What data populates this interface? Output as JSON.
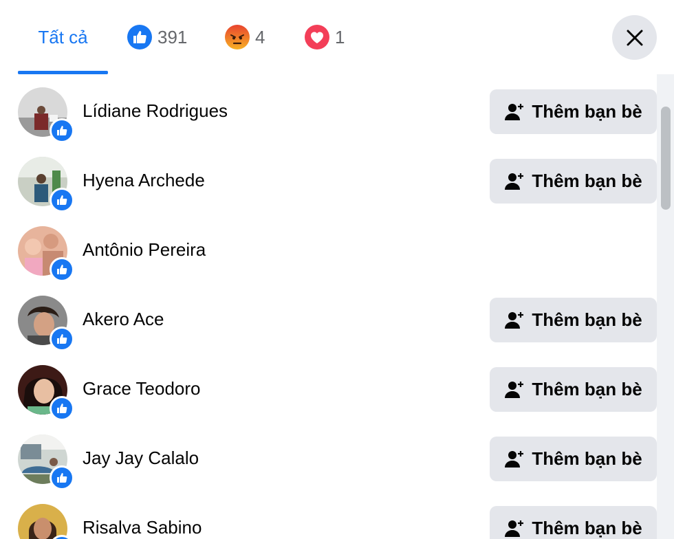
{
  "tabs": {
    "all_label": "Tất cả",
    "like_count": "391",
    "angry_count": "4",
    "love_count": "1"
  },
  "colors": {
    "accent": "#1877f2",
    "button_bg": "#e4e6eb",
    "like": "#1877f2",
    "angry": "#f0543c",
    "love": "#f33e58"
  },
  "icons": {
    "like": "thumbs-up-icon",
    "angry": "angry-face-icon",
    "love": "heart-icon",
    "close": "close-icon",
    "add_friend": "person-add-icon"
  },
  "people": [
    {
      "name": "Lídiane Rodrigues",
      "reaction": "like",
      "show_add": true,
      "button_label": "Thêm bạn bè"
    },
    {
      "name": "Hyena Archede",
      "reaction": "like",
      "show_add": true,
      "button_label": "Thêm bạn bè"
    },
    {
      "name": "Antônio Pereira",
      "reaction": "like",
      "show_add": false,
      "button_label": ""
    },
    {
      "name": "Akero Ace",
      "reaction": "like",
      "show_add": true,
      "button_label": "Thêm bạn bè"
    },
    {
      "name": "Grace Teodoro",
      "reaction": "like",
      "show_add": true,
      "button_label": "Thêm bạn bè"
    },
    {
      "name": "Jay Jay Calalo",
      "reaction": "like",
      "show_add": true,
      "button_label": "Thêm bạn bè"
    },
    {
      "name": "Risalva Sabino",
      "reaction": "like",
      "show_add": true,
      "button_label": "Thêm bạn bè"
    }
  ]
}
